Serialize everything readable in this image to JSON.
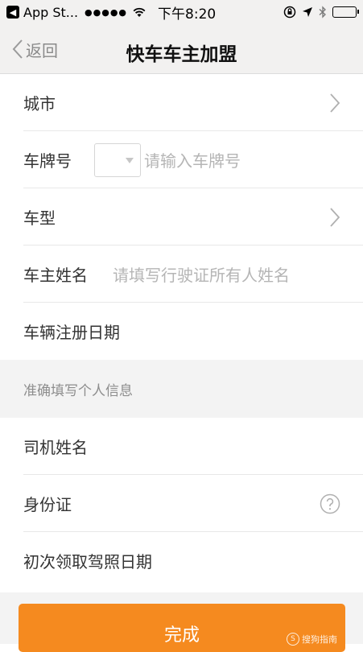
{
  "status_bar": {
    "back_app": "App St...",
    "signal": "●●●●●",
    "time": "下午8:20"
  },
  "nav": {
    "back_label": "返回",
    "title": "快车车主加盟"
  },
  "form": {
    "city_label": "城市",
    "plate_label": "车牌号",
    "plate_placeholder": "请输入车牌号",
    "model_label": "车型",
    "owner_label": "车主姓名",
    "owner_placeholder": "请填写行驶证所有人姓名",
    "reg_date_label": "车辆注册日期",
    "section_title": "准确填写个人信息",
    "driver_name_label": "司机姓名",
    "id_label": "身份证",
    "license_date_label": "初次领取驾照日期"
  },
  "submit_label": "完成",
  "watermark": {
    "text": "搜狗指南",
    "logo": "S"
  },
  "colors": {
    "accent": "#f58a1f",
    "nav_bg": "#f2f1f0",
    "section_bg": "#f3f3f3"
  }
}
